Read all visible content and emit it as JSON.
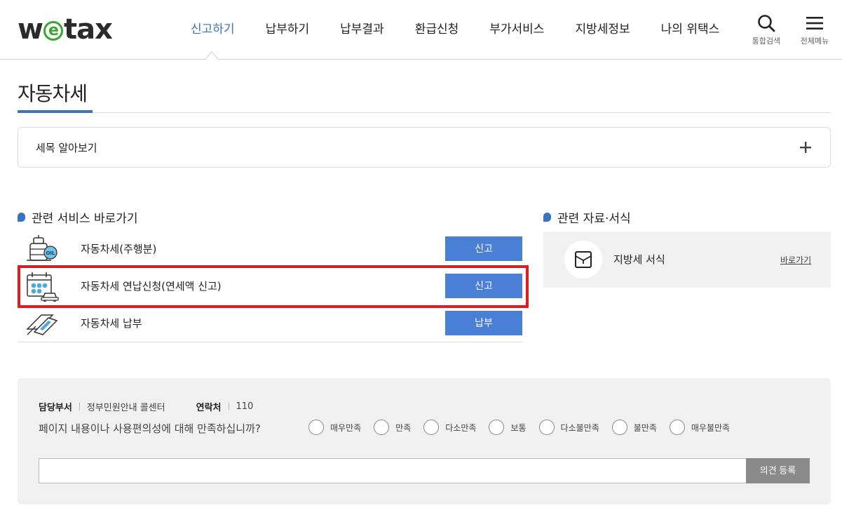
{
  "header": {
    "logo": {
      "part1": "w",
      "part2": "e",
      "part3": "tax"
    },
    "nav": [
      {
        "label": "신고하기",
        "active": true
      },
      {
        "label": "납부하기",
        "active": false
      },
      {
        "label": "납부결과",
        "active": false
      },
      {
        "label": "환급신청",
        "active": false
      },
      {
        "label": "부가서비스",
        "active": false
      },
      {
        "label": "지방세정보",
        "active": false
      },
      {
        "label": "나의 위택스",
        "active": false
      }
    ],
    "search_label": "통합검색",
    "menu_label": "전체메뉴"
  },
  "page": {
    "title": "자동차세",
    "accordion_label": "세목 알아보기"
  },
  "services": {
    "heading": "관련 서비스 바로가기",
    "items": [
      {
        "name": "자동차세(주행분)",
        "button": "신고",
        "icon": "oil-tank-icon"
      },
      {
        "name": "자동차세 연납신청(연세액 신고)",
        "button": "신고",
        "icon": "calendar-car-icon"
      },
      {
        "name": "자동차세 납부",
        "button": "납부",
        "icon": "card-payment-icon"
      }
    ]
  },
  "resources": {
    "heading": "관련 자료·서식",
    "item_name": "지방세 서식",
    "link": "바로가기"
  },
  "feedback": {
    "dept_label": "담당부서",
    "dept_value": "정부민원안내 콜센터",
    "contact_label": "연락처",
    "contact_value": "110",
    "question": "페이지 내용이나 사용편의성에 대해 만족하십니까?",
    "options": [
      "매우만족",
      "만족",
      "다소만족",
      "보통",
      "다소불만족",
      "불만족",
      "매우불만족"
    ],
    "submit": "의견 등록"
  },
  "colors": {
    "accent": "#3a72c4",
    "button": "#4a7fd6",
    "highlight": "#e01b24",
    "logo_green": "#3aa535"
  }
}
